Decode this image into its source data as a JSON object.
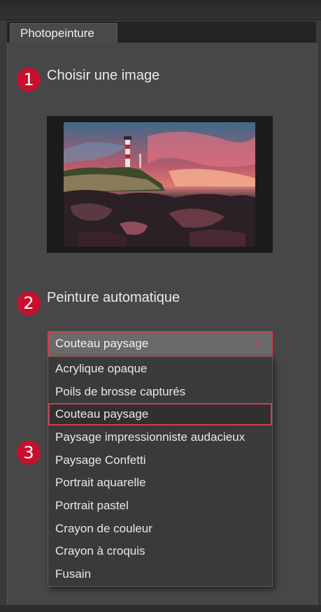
{
  "panel": {
    "tab_label": "Photopeinture"
  },
  "steps": [
    {
      "number": "1",
      "label": "Choisir une image"
    },
    {
      "number": "2",
      "label": "Peinture automatique"
    },
    {
      "number": "3"
    }
  ],
  "select": {
    "value": "Couteau paysage"
  },
  "dropdown": {
    "options": [
      "Acrylique opaque",
      "Poils de brosse capturés",
      "Couteau paysage",
      "Paysage impressionniste audacieux",
      "Paysage Confetti",
      "Portrait aquarelle",
      "Portrait pastel",
      "Crayon de couleur",
      "Crayon à croquis",
      "Fusain"
    ],
    "selected": "Couteau paysage"
  },
  "colors": {
    "accent": "#c8102e",
    "highlight_border": "#d23c4b"
  },
  "icons": {
    "select_arrow": "chevron-down-icon"
  }
}
